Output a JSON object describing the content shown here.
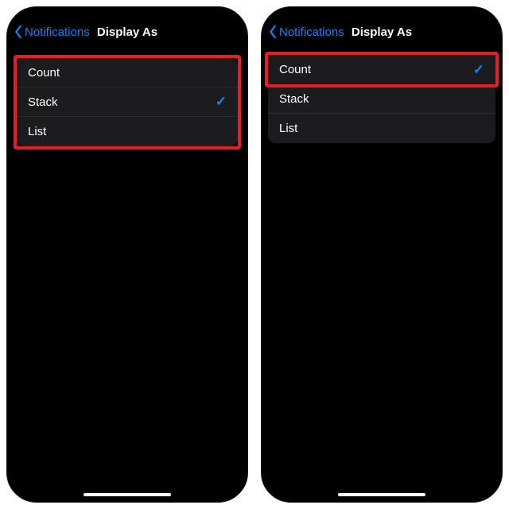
{
  "colors": {
    "accent_blue": "#0a84ff",
    "highlight_red": "#ed1c24",
    "row_bg": "#1c1c1e"
  },
  "screens": [
    {
      "back_label": "Notifications",
      "title": "Display As",
      "options": [
        {
          "label": "Count",
          "selected": false
        },
        {
          "label": "Stack",
          "selected": true
        },
        {
          "label": "List",
          "selected": false
        }
      ],
      "highlight": "all-rows"
    },
    {
      "back_label": "Notifications",
      "title": "Display As",
      "options": [
        {
          "label": "Count",
          "selected": true
        },
        {
          "label": "Stack",
          "selected": false
        },
        {
          "label": "List",
          "selected": false
        }
      ],
      "highlight": "first-row"
    }
  ],
  "check_glyph": "✓"
}
